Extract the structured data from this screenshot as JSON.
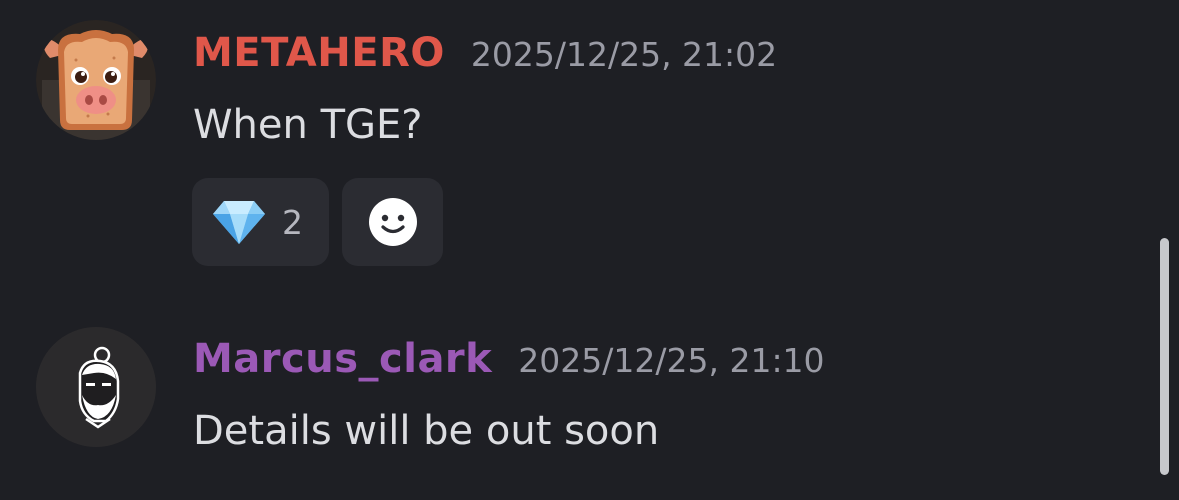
{
  "messages": [
    {
      "username": "METAHERO",
      "username_color": "#e0574a",
      "timestamp": "2025/12/25, 21:02",
      "content": "When TGE?",
      "avatar": "pig-toast-avatar",
      "reactions": [
        {
          "emoji": "gem-icon",
          "count": "2"
        }
      ],
      "add_reaction_icon": "smiley-icon"
    },
    {
      "username": "Marcus_clark",
      "username_color": "#9b59b6",
      "timestamp": "2025/12/25, 21:10",
      "content": "Details will be out soon",
      "avatar": "bearded-man-avatar"
    }
  ]
}
